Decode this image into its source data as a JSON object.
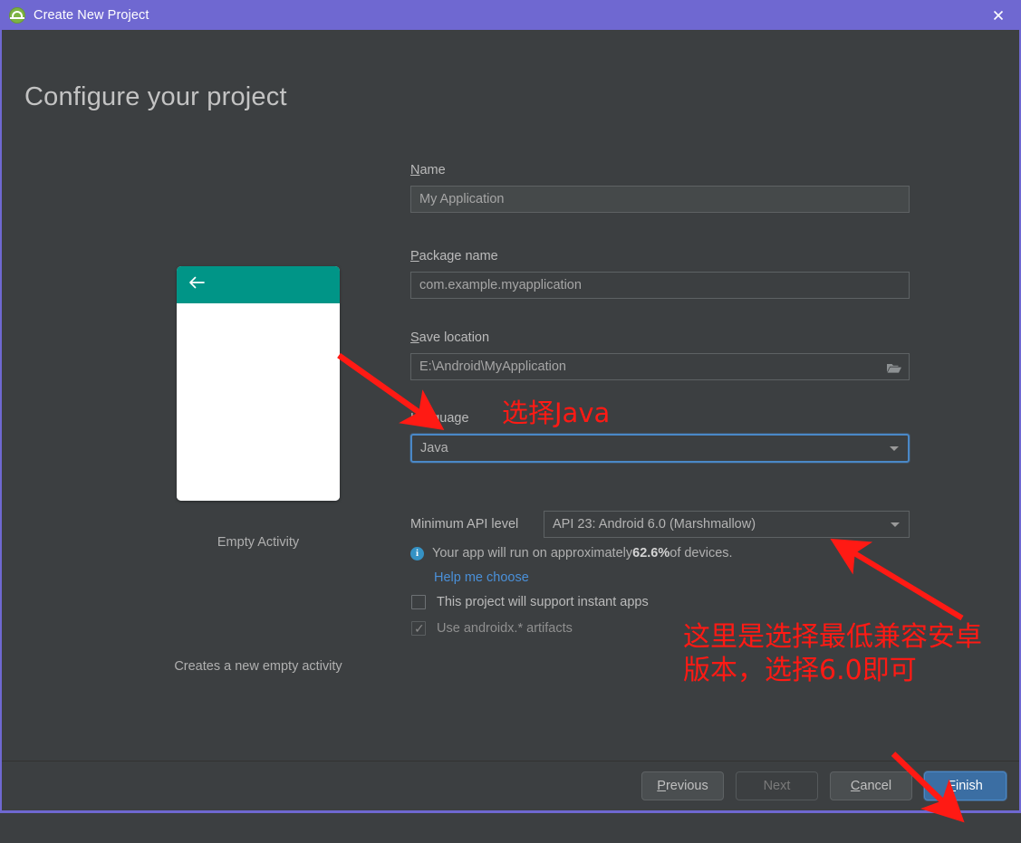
{
  "window": {
    "title": "Create New Project",
    "app_icon": "android-studio-icon",
    "close_icon": "close-icon",
    "accent_purple": "#6f68d1",
    "background": "#3c3f41"
  },
  "page": {
    "heading": "Configure your project"
  },
  "preview": {
    "back_icon": "arrow-left-icon",
    "appbar_color": "#009587",
    "template_name": "Empty Activity",
    "template_description": "Creates a new empty activity"
  },
  "form": {
    "name": {
      "label_mnemonic": "N",
      "label_rest": "ame",
      "value": "My Application"
    },
    "package": {
      "label_mnemonic": "P",
      "label_rest": "ackage name",
      "value": "com.example.myapplication"
    },
    "save_location": {
      "label_mnemonic": "S",
      "label_rest": "ave location",
      "value": "E:\\Android\\MyApplication",
      "browse_icon": "folder-icon"
    },
    "language": {
      "label_mnemonic": "L",
      "label_rest": "anguage",
      "value": "Java",
      "focused": true,
      "dropdown_icon": "chevron-down-icon",
      "focus_color": "#4a88c7"
    },
    "min_api": {
      "label": "Minimum API level",
      "value": "API 23: Android 6.0 (Marshmallow)",
      "dropdown_icon": "chevron-down-icon"
    },
    "devices_info": {
      "icon": "info-icon",
      "prefix": "Your app will run on approximately ",
      "percent": "62.6%",
      "suffix": " of devices.",
      "link": "Help me choose",
      "link_color": "#4a90d9"
    },
    "instant_apps": {
      "label": "This project will support instant apps",
      "checked": false
    },
    "androidx": {
      "label": "Use androidx.* artifacts",
      "checked": true,
      "disabled": true,
      "tick": "✓"
    }
  },
  "footer": {
    "previous": {
      "mnemonic": "P",
      "rest": "revious",
      "disabled": false
    },
    "next": {
      "mnemonic": "",
      "rest": "Next",
      "disabled": true
    },
    "cancel": {
      "mnemonic": "C",
      "rest": "ancel",
      "disabled": false
    },
    "finish": {
      "mnemonic": "F",
      "rest": "inish",
      "primary": true
    }
  },
  "annotations": {
    "color": "#ff1a14",
    "select_java": "选择Java",
    "min_api_line1": "这里是选择最低兼容安卓",
    "min_api_line2": "版本，选择6.0即可"
  }
}
